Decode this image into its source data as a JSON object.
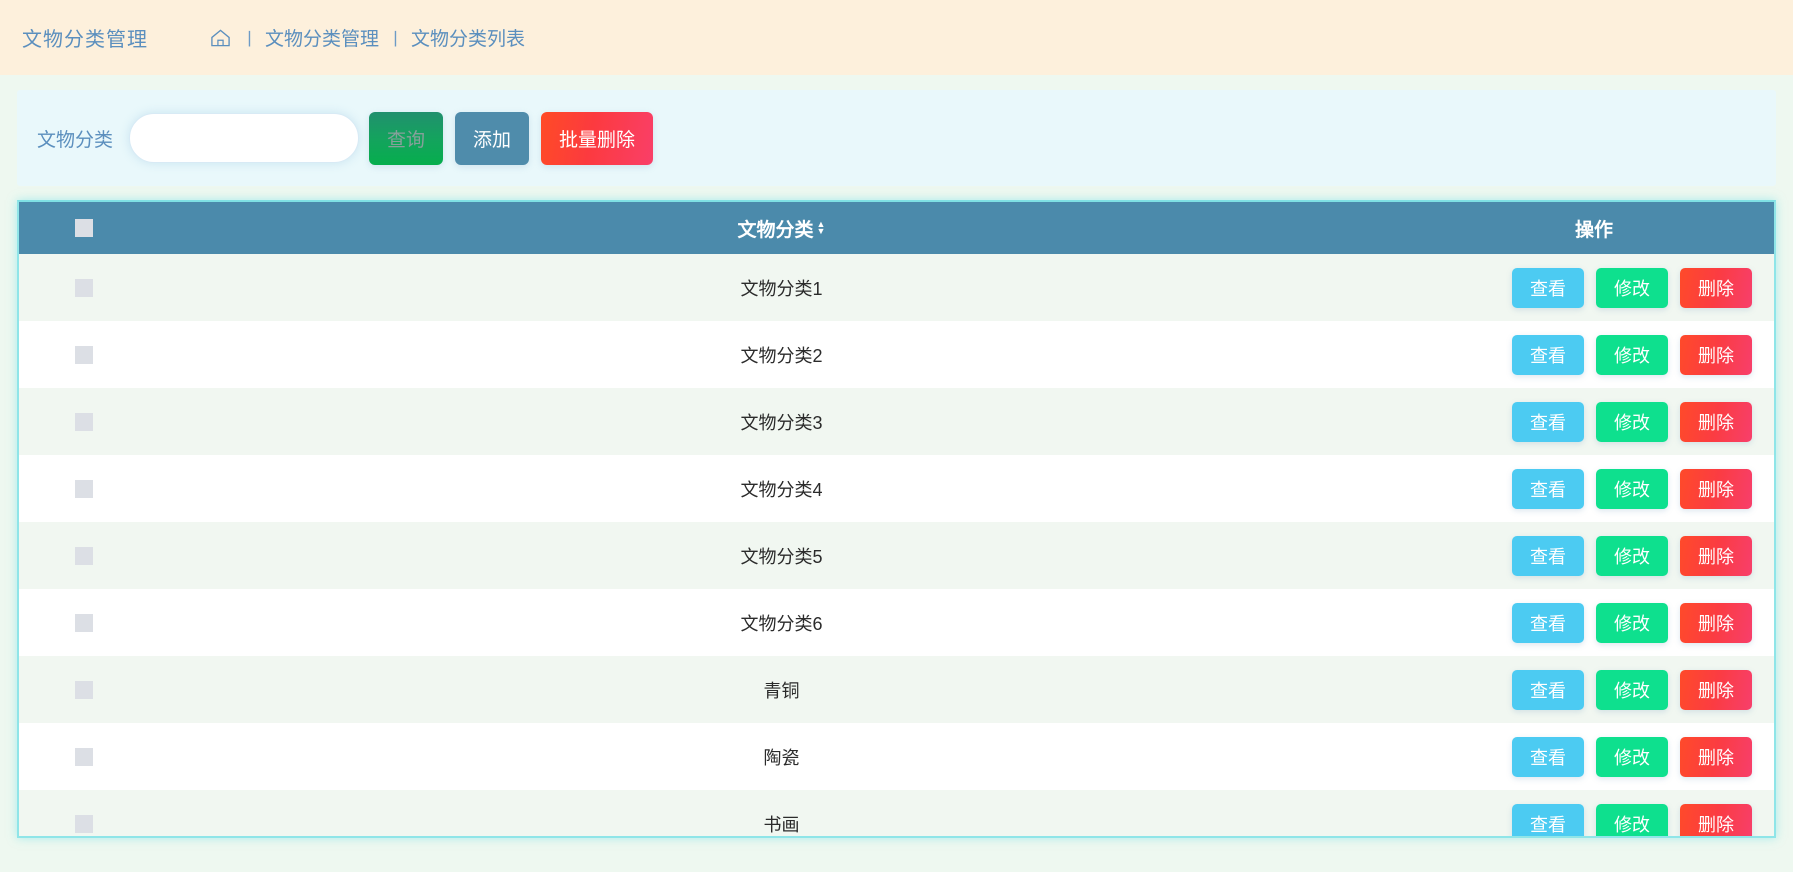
{
  "header": {
    "title": "文物分类管理",
    "breadcrumb": {
      "home_icon": "home-icon",
      "sep": "丨",
      "items": [
        "文物分类管理",
        "文物分类列表"
      ]
    }
  },
  "toolbar": {
    "search_label": "文物分类",
    "search_value": "",
    "search_placeholder": "",
    "query_label": "查询",
    "add_label": "添加",
    "batch_delete_label": "批量删除"
  },
  "table": {
    "columns": {
      "select_all": "",
      "name": "文物分类",
      "sort_icon": "sort-arrows-icon",
      "action": "操作"
    },
    "row_actions": {
      "view": "查看",
      "edit": "修改",
      "delete": "删除"
    },
    "rows": [
      {
        "name": "文物分类1"
      },
      {
        "name": "文物分类2"
      },
      {
        "name": "文物分类3"
      },
      {
        "name": "文物分类4"
      },
      {
        "name": "文物分类5"
      },
      {
        "name": "文物分类6"
      },
      {
        "name": "青铜"
      },
      {
        "name": "陶瓷"
      },
      {
        "name": "书画"
      }
    ]
  },
  "colors": {
    "topbar_bg": "#fdf0dc",
    "topbar_text": "#5b8fbe",
    "search_panel_bg": "#e9f8fb",
    "table_header_bg": "#4b8aab",
    "table_border": "#8fe5e8",
    "row_odd_bg": "#f1f7f1",
    "row_even_bg": "#ffffff",
    "btn_add": "#4f8cab",
    "btn_view": "#4ccbf2",
    "btn_edit": "#0ee08e",
    "btn_delete": "#fb3c42",
    "page_bg": "#eef8f0"
  }
}
